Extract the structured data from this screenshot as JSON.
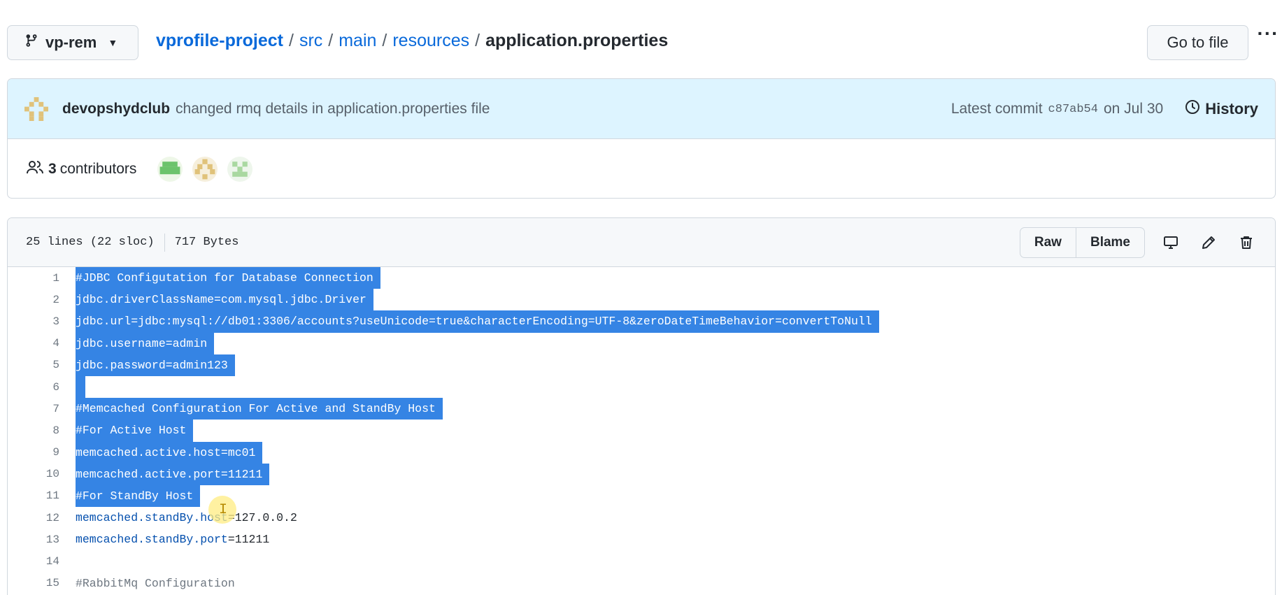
{
  "branch": {
    "name": "vp-rem",
    "icon": "git-branch-icon"
  },
  "breadcrumb": {
    "repo": "vprofile-project",
    "parts": [
      "src",
      "main",
      "resources"
    ],
    "file": "application.properties",
    "sep": "/"
  },
  "header": {
    "goto_label": "Go to file",
    "more_label": "···"
  },
  "commit": {
    "author": "devopshydclub",
    "message": "changed rmq details in application.properties file",
    "latest_label": "Latest commit",
    "hash": "c87ab54",
    "date": "on Jul 30",
    "history_label": "History"
  },
  "contributors": {
    "count": "3",
    "label": "contributors"
  },
  "file": {
    "lines_info": "25 lines (22 sloc)",
    "size": "717 Bytes",
    "raw_label": "Raw",
    "blame_label": "Blame"
  },
  "code": {
    "line_numbers": [
      "1",
      "2",
      "3",
      "4",
      "5",
      "6",
      "7",
      "8",
      "9",
      "10",
      "11",
      "12",
      "13",
      "14",
      "15"
    ],
    "l1": "#JDBC Configutation for Database Connection",
    "l2": "jdbc.driverClassName=com.mysql.jdbc.Driver",
    "l3": "jdbc.url=jdbc:mysql://db01:3306/accounts?useUnicode=true&characterEncoding=UTF-8&zeroDateTimeBehavior=convertToNull",
    "l4": "jdbc.username=admin",
    "l5": "jdbc.password=admin123",
    "l7": "#Memcached Configuration For Active and StandBy Host",
    "l8": "#For Active Host",
    "l9": "memcached.active.host=mc01",
    "l10": "memcached.active.port=11211",
    "l11": "#For StandBy Host",
    "l12_key": "memcached.standBy.host",
    "l12_val": "=127.0.0.2",
    "l13_key": "memcached.standBy.port",
    "l13_val": "=11211",
    "l15": "#RabbitMq Configuration"
  },
  "colors": {
    "link": "#0969da",
    "commit_bg": "#ddf4ff",
    "selection": "#3584e4"
  }
}
